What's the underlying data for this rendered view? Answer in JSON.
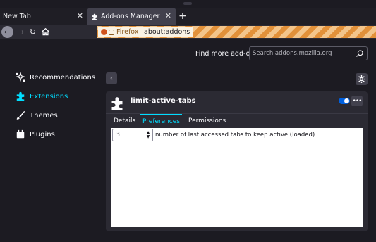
{
  "tabs": [
    {
      "label": "New Tab"
    },
    {
      "label": "Add-ons Manager"
    }
  ],
  "toolbar": {
    "identity_label": "Firefox",
    "url": "about:addons"
  },
  "header": {
    "find_more_label": "Find more add-ons",
    "search_placeholder": "Search addons.mozilla.org"
  },
  "sidebar": {
    "items": [
      {
        "label": "Recommendations",
        "icon": "recommendations-icon"
      },
      {
        "label": "Extensions",
        "icon": "puzzle-icon",
        "selected": true
      },
      {
        "label": "Themes",
        "icon": "brush-icon"
      },
      {
        "label": "Plugins",
        "icon": "plugin-icon"
      }
    ]
  },
  "addon": {
    "name": "limit-active-tabs",
    "enabled": true,
    "tabs": [
      {
        "label": "Details"
      },
      {
        "label": "Preferences",
        "selected": true
      },
      {
        "label": "Permissions"
      }
    ],
    "prefs": {
      "value": "3",
      "label": "number of last accessed tabs to keep active (loaded)"
    }
  },
  "colors": {
    "accent": "#00ddff",
    "toggle_on": "#0060df",
    "background": "#1c1b22",
    "card": "#2b2a33"
  }
}
